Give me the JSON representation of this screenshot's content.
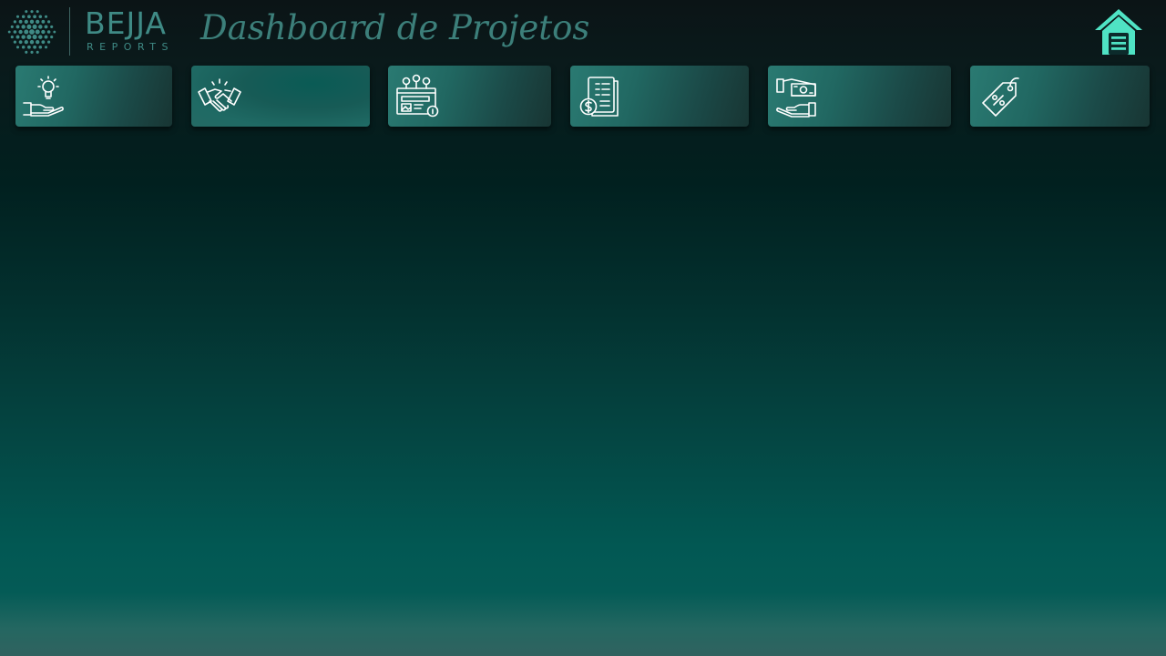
{
  "header": {
    "brand_name": "BEJJA",
    "brand_sub": "REPORTS",
    "title": "Dashboard de Projetos"
  },
  "nav": {
    "items": [
      {
        "icon": "hand-lightbulb-icon",
        "label": ""
      },
      {
        "icon": "handshake-icon",
        "label": ""
      },
      {
        "icon": "team-presentation-icon",
        "label": ""
      },
      {
        "icon": "invoice-checklist-icon",
        "label": ""
      },
      {
        "icon": "hand-money-icon",
        "label": ""
      },
      {
        "icon": "discount-tag-icon",
        "label": ""
      }
    ],
    "active_index": 1
  },
  "home": {
    "icon": "home-icon"
  },
  "colors": {
    "accent": "#4fe3c4",
    "brand": "#3f8a85",
    "title": "#3c7f7a",
    "button": "#216862"
  }
}
